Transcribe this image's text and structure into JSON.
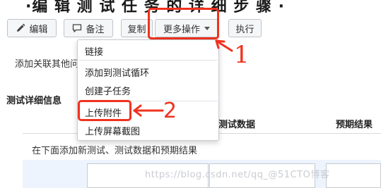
{
  "title_fragment": "·编 辑 测 试 任 务 的 详 细 步 骤 ·",
  "toolbar": {
    "edit_label": "编辑",
    "comment_label": "备注",
    "copy_label": "复制",
    "more_actions_label": "更多操作",
    "run_label": "执行"
  },
  "link_row_text": "添加关联其他问题",
  "section_title": "测试详细信息",
  "table": {
    "headers": [
      "测试数据",
      "预期结果"
    ],
    "instruction": "在下面添加新测试、测试数据和预期结果"
  },
  "dropdown": {
    "items": [
      "链接",
      "添加到测试循环",
      "创建子任务",
      "上传附件",
      "上传屏幕截图"
    ]
  },
  "annotations": {
    "marker_1": "1",
    "marker_2": "2"
  },
  "watermark": "https://blog.csdn.net/qq_@51CTO博客",
  "colors": {
    "highlight": "#f0321e",
    "grid_background": "#eef4fd"
  },
  "icons": [
    "pencil-icon",
    "speech-bubble-icon",
    "caret-down-icon"
  ]
}
